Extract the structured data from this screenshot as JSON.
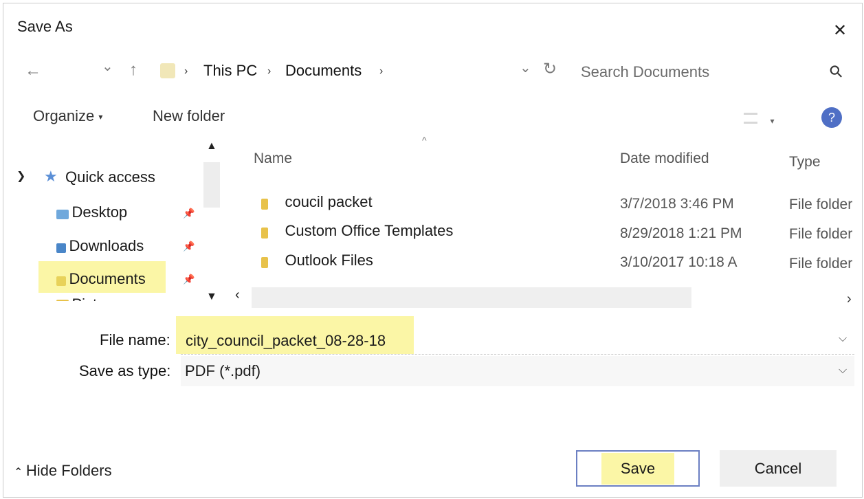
{
  "window": {
    "title": "Save As",
    "close_glyph": "✕"
  },
  "address_bar": {
    "back_glyph": "←",
    "dropdown_glyph": "⌄",
    "up_glyph": "↑",
    "breadcrumbs": [
      "This PC",
      "Documents"
    ],
    "breadcrumb_separator": "›",
    "refresh_glyph": "↻",
    "search_placeholder": "Search Documents",
    "search_glyph": "⚲"
  },
  "toolbar": {
    "organize_label": "Organize",
    "new_folder_label": "New folder",
    "help_glyph": "?"
  },
  "nav_pane": {
    "quick_access_label": "Quick access",
    "items": [
      {
        "label": "Desktop",
        "icon": "desktop-folder-icon"
      },
      {
        "label": "Downloads",
        "icon": "downloads-icon"
      },
      {
        "label": "Documents",
        "icon": "documents-folder-icon",
        "selected": true
      }
    ],
    "partial_item": "Pict"
  },
  "file_list": {
    "columns": [
      "Name",
      "Date modified",
      "Type"
    ],
    "rows": [
      {
        "name": "coucil packet",
        "date": "3/7/2018 3:46 PM",
        "type": "File folder"
      },
      {
        "name": "Custom Office Templates",
        "date": "8/29/2018 1:21 PM",
        "type": "File folder"
      },
      {
        "name": "Outlook Files",
        "date": "3/10/2017 10:18 A",
        "type": "File folder"
      }
    ]
  },
  "form": {
    "file_name_label": "File name:",
    "file_name_value": "city_council_packet_08-28-18",
    "save_as_type_label": "Save as type:",
    "save_as_type_value": "PDF (*.pdf)"
  },
  "footer": {
    "hide_folders_label": "Hide Folders",
    "save_label": "Save",
    "cancel_label": "Cancel"
  },
  "colors": {
    "highlight": "#fbf6a6",
    "folder": "#e8c24a",
    "quick_access_star": "#5b8fd6",
    "help_circle": "#4f6fc5",
    "save_border": "#6b7fc2"
  }
}
